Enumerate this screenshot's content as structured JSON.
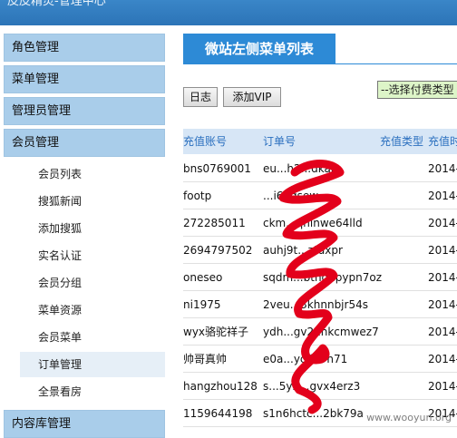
{
  "header": {
    "title": "皮皮精灵-管理中心"
  },
  "sidebar": {
    "sections": [
      {
        "label": "角色管理"
      },
      {
        "label": "菜单管理"
      },
      {
        "label": "管理员管理"
      },
      {
        "label": "会员管理"
      }
    ],
    "items": [
      {
        "label": "会员列表"
      },
      {
        "label": "搜狐新闻"
      },
      {
        "label": "添加搜狐"
      },
      {
        "label": "实名认证"
      },
      {
        "label": "会员分组"
      },
      {
        "label": "菜单资源"
      },
      {
        "label": "会员菜单"
      },
      {
        "label": "订单管理"
      },
      {
        "label": "全景看房"
      }
    ],
    "bottom_section": {
      "label": "内容库管理"
    }
  },
  "main": {
    "panel_title": "微站左侧菜单列表",
    "buttons": {
      "log": "日志",
      "add_vip": "添加VIP"
    },
    "select": {
      "value": "--选择付费类型"
    },
    "table": {
      "headers": [
        "充值账号",
        "订单号",
        "充值类型",
        "充值时"
      ],
      "rows": [
        {
          "account": "bns0769001",
          "order": "eu...h2...dkao",
          "type": "",
          "time": "2014-"
        },
        {
          "account": "footp",
          "order": "...i67qsew",
          "type": "",
          "time": "2014-"
        },
        {
          "account": "272285011",
          "order": "ckm...qhinwe64lld",
          "type": "",
          "time": "2014-"
        },
        {
          "account": "2694797502",
          "order": "auhj9t...ztdxpr",
          "type": "",
          "time": "2014-"
        },
        {
          "account": "oneseo",
          "order": "sqdm...bthg1pypn7oz",
          "type": "",
          "time": "2014-"
        },
        {
          "account": "ni1975",
          "order": "2veu...3khnnbjr54s",
          "type": "",
          "time": "2014-"
        },
        {
          "account": "wyx骆驼祥子",
          "order": "ydh...gv21nkcmwez7",
          "type": "",
          "time": "2014-"
        },
        {
          "account": "帅哥真帅",
          "order": "e0a...ycif29n71",
          "type": "",
          "time": "2014-"
        },
        {
          "account": "hangzhou128",
          "order": "s...5yb...gvx4erz3",
          "type": "",
          "time": "2014-"
        },
        {
          "account": "1159644198",
          "order": "s1n6hctc...2bk79a",
          "type": "",
          "time": "2014-"
        }
      ]
    }
  },
  "watermark": "www.wooyun.org",
  "colors": {
    "accent": "#2d8ad6",
    "sidebar_section": "#a9cdea",
    "table_header": "#d7e6f6",
    "redaction": "#e3001b"
  }
}
